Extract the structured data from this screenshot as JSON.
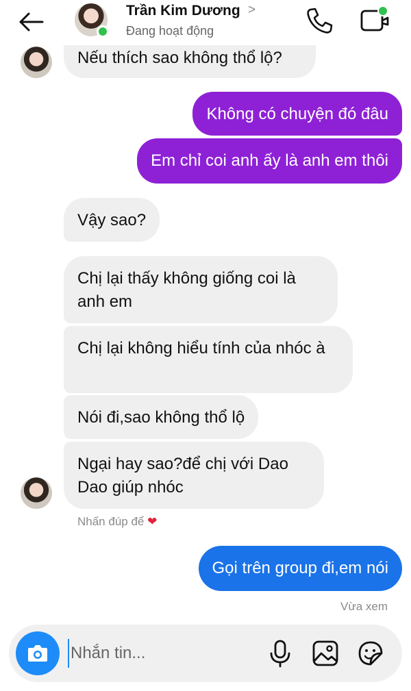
{
  "header": {
    "name": "Trần Kim Dương",
    "status": "Đang hoạt động",
    "chevron": ">"
  },
  "messages": [
    {
      "from": "them",
      "text": "Nếu thích sao không thổ lộ?"
    },
    {
      "from": "me",
      "text": "Không có chuyện đó đâu"
    },
    {
      "from": "me",
      "text": "Em chỉ coi anh ấy là anh em thôi"
    },
    {
      "from": "them",
      "text": "Vậy sao?"
    },
    {
      "from": "them",
      "text": "Chị lại thấy không giống coi là anh em"
    },
    {
      "from": "them",
      "text": "Chị lại không hiểu tính của nhóc à"
    },
    {
      "from": "them",
      "text": "Nói đi,sao không thổ lộ"
    },
    {
      "from": "them",
      "text": "Ngại hay sao?để chị với Dao Dao giúp nhóc"
    },
    {
      "from": "me",
      "text": "Gọi trên group đi,em nói"
    }
  ],
  "hint": {
    "text": "Nhấn đúp để",
    "heart": "❤"
  },
  "seen": "Vừa xem",
  "composer": {
    "placeholder": "Nhắn tin..."
  },
  "colors": {
    "outgoing_purple": "#8e21d6",
    "outgoing_blue": "#1a73e8",
    "incoming": "#efefef",
    "accent": "#1d8cf8",
    "online": "#31c24d"
  },
  "icons": [
    "back-arrow-icon",
    "phone-icon",
    "video-call-icon",
    "camera-icon",
    "microphone-icon",
    "gallery-icon",
    "sticker-icon",
    "heart-icon"
  ]
}
